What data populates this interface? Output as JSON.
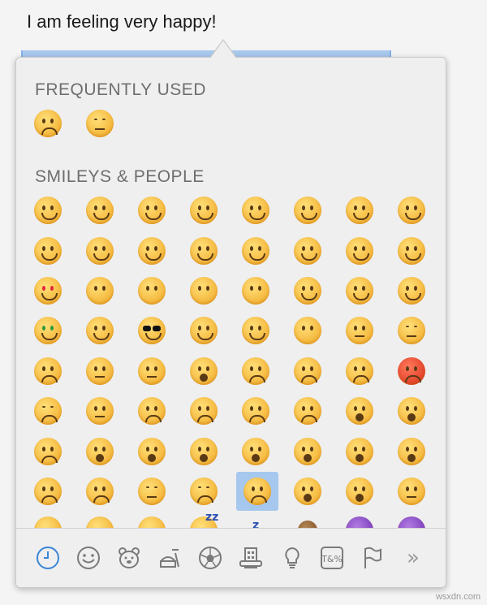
{
  "text_field": {
    "value": "I am feeling very happy!"
  },
  "picker": {
    "sections": [
      {
        "title": "FREQUENTLY USED"
      },
      {
        "title": "SMILEYS & PEOPLE"
      }
    ],
    "selected_emoji": "loudly-crying-face",
    "toolbar": [
      {
        "name": "frequently-used",
        "icon": "clock-icon",
        "active": true
      },
      {
        "name": "smileys-people",
        "icon": "smiley-icon",
        "active": false
      },
      {
        "name": "animals-nature",
        "icon": "bear-icon",
        "active": false
      },
      {
        "name": "food-drink",
        "icon": "food-icon",
        "active": false
      },
      {
        "name": "activity",
        "icon": "soccer-ball-icon",
        "active": false
      },
      {
        "name": "travel-places",
        "icon": "building-icon",
        "active": false
      },
      {
        "name": "objects",
        "icon": "lightbulb-icon",
        "active": false
      },
      {
        "name": "symbols",
        "icon": "symbols-icon",
        "active": false
      },
      {
        "name": "flags",
        "icon": "flag-icon",
        "active": false
      },
      {
        "name": "more",
        "icon": "chevron-double-right-icon",
        "active": false
      }
    ],
    "symbols_icon_text": "T&%",
    "more_text": "»"
  },
  "watermark": "wsxdn.com",
  "accent_color": "#3a86d6"
}
